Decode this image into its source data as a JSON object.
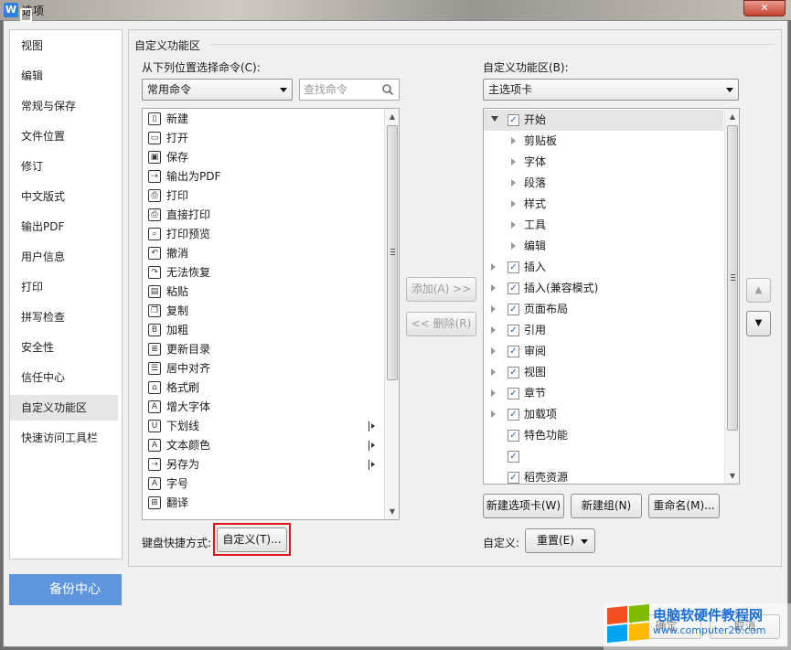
{
  "window": {
    "title": "选项",
    "app_icon": "W",
    "close_glyph": "✕"
  },
  "nav": {
    "items": [
      "视图",
      "编辑",
      "常规与保存",
      "文件位置",
      "修订",
      "中文版式",
      "输出PDF",
      "用户信息",
      "打印",
      "拼写检查",
      "安全性",
      "信任中心",
      "自定义功能区",
      "快速访问工具栏"
    ],
    "selected_index": 12
  },
  "backup_label": "备份中心",
  "section_title": "自定义功能区",
  "left": {
    "label": "从下列位置选择命令(C):",
    "combo_value": "常用命令",
    "search_placeholder": "查找命令",
    "commands": [
      {
        "icon": "new-doc-icon",
        "glyph": "▯",
        "label": "新建",
        "sub": false
      },
      {
        "icon": "open-folder-icon",
        "glyph": "▭",
        "label": "打开",
        "sub": false
      },
      {
        "icon": "save-icon",
        "glyph": "▣",
        "label": "保存",
        "sub": false
      },
      {
        "icon": "export-pdf-icon",
        "glyph": "⇢",
        "label": "输出为PDF",
        "sub": false
      },
      {
        "icon": "printer-icon",
        "glyph": "⎙",
        "label": "打印",
        "sub": false
      },
      {
        "icon": "direct-print-icon",
        "glyph": "⎙",
        "label": "直接打印",
        "sub": false
      },
      {
        "icon": "print-preview-icon",
        "glyph": "⌕",
        "label": "打印预览",
        "sub": false
      },
      {
        "icon": "undo-icon",
        "glyph": "↶",
        "label": "撤消",
        "sub": false
      },
      {
        "icon": "redo-icon",
        "glyph": "↷",
        "label": "无法恢复",
        "sub": false
      },
      {
        "icon": "paste-icon",
        "glyph": "▤",
        "label": "粘贴",
        "sub": false
      },
      {
        "icon": "copy-icon",
        "glyph": "❐",
        "label": "复制",
        "sub": false
      },
      {
        "icon": "bold-icon",
        "glyph": "B",
        "label": "加粗",
        "sub": false
      },
      {
        "icon": "update-toc-icon",
        "glyph": "≣",
        "label": "更新目录",
        "sub": false
      },
      {
        "icon": "align-center-icon",
        "glyph": "☰",
        "label": "居中对齐",
        "sub": false
      },
      {
        "icon": "format-painter-icon",
        "glyph": "⌂",
        "label": "格式刷",
        "sub": false
      },
      {
        "icon": "grow-font-icon",
        "glyph": "A",
        "label": "增大字体",
        "sub": false
      },
      {
        "icon": "underline-icon",
        "glyph": "U",
        "label": "下划线",
        "sub": true
      },
      {
        "icon": "font-color-icon",
        "glyph": "A",
        "label": "文本颜色",
        "sub": true
      },
      {
        "icon": "save-as-icon",
        "glyph": "⇢",
        "label": "另存为",
        "sub": true
      },
      {
        "icon": "font-size-icon",
        "glyph": "A",
        "label": "字号",
        "sub": false
      },
      {
        "icon": "translate-icon",
        "glyph": "⊞",
        "label": "翻译",
        "sub": false
      }
    ]
  },
  "middle": {
    "add_label": "添加(A) >>",
    "remove_label": "<< 删除(R)"
  },
  "right": {
    "label": "自定义功能区(B):",
    "combo_value": "主选项卡",
    "tree": [
      {
        "label": "开始",
        "level": 0,
        "expand": "open",
        "checked": true,
        "selected": true
      },
      {
        "label": "剪贴板",
        "level": 1,
        "expand": "closed",
        "checked": null,
        "selected": false
      },
      {
        "label": "字体",
        "level": 1,
        "expand": "closed",
        "checked": null,
        "selected": false
      },
      {
        "label": "段落",
        "level": 1,
        "expand": "closed",
        "checked": null,
        "selected": false
      },
      {
        "label": "样式",
        "level": 1,
        "expand": "closed",
        "checked": null,
        "selected": false
      },
      {
        "label": "工具",
        "level": 1,
        "expand": "closed",
        "checked": null,
        "selected": false
      },
      {
        "label": "编辑",
        "level": 1,
        "expand": "closed",
        "checked": null,
        "selected": false
      },
      {
        "label": "插入",
        "level": 0,
        "expand": "closed",
        "checked": true,
        "selected": false
      },
      {
        "label": "插入(兼容模式)",
        "level": 0,
        "expand": "closed",
        "checked": true,
        "selected": false
      },
      {
        "label": "页面布局",
        "level": 0,
        "expand": "closed",
        "checked": true,
        "selected": false
      },
      {
        "label": "引用",
        "level": 0,
        "expand": "closed",
        "checked": true,
        "selected": false
      },
      {
        "label": "审阅",
        "level": 0,
        "expand": "closed",
        "checked": true,
        "selected": false
      },
      {
        "label": "视图",
        "level": 0,
        "expand": "closed",
        "checked": true,
        "selected": false
      },
      {
        "label": "章节",
        "level": 0,
        "expand": "closed",
        "checked": true,
        "selected": false
      },
      {
        "label": "加载项",
        "level": 0,
        "expand": "closed",
        "checked": true,
        "selected": false
      },
      {
        "label": "特色功能",
        "level": 0,
        "expand": "none",
        "checked": true,
        "selected": false
      },
      {
        "label": "",
        "level": 0,
        "expand": "none",
        "checked": true,
        "selected": false
      },
      {
        "label": "稻壳资源",
        "level": 0,
        "expand": "none",
        "checked": true,
        "selected": false
      }
    ],
    "new_tab_label": "新建选项卡(W)",
    "new_group_label": "新建组(N)",
    "rename_label": "重命名(M)...",
    "custom_label": "自定义:",
    "reset_label": "重置(E)"
  },
  "shortcut": {
    "label": "键盘快捷方式:",
    "button_label": "自定义(T)..."
  },
  "footer": {
    "ok_label": "确定",
    "cancel_label": "取消"
  },
  "watermark": {
    "title": "电脑软硬件教程网",
    "url": "www.computer26.com"
  },
  "colors": {
    "nav_selected": "#e6e6e6",
    "backup_bg": "#5f95dc",
    "highlight_frame": "#e1131a",
    "watermark_text": "#1a6fd8"
  }
}
